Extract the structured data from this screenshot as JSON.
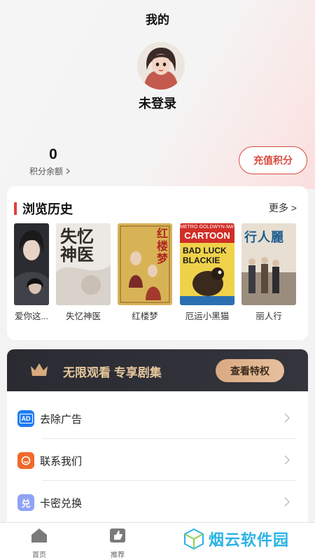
{
  "header": {
    "title": "我的"
  },
  "profile": {
    "username": "未登录",
    "points_value": "0",
    "points_label": "积分余额",
    "recharge_label": "充值积分"
  },
  "history": {
    "title": "浏览历史",
    "more_label": "更多 >",
    "items": [
      {
        "title": "爱你这...",
        "poster_text": ""
      },
      {
        "title": "失忆神医",
        "poster_text": "失忆神医"
      },
      {
        "title": "红楼梦",
        "poster_text": "红楼梦"
      },
      {
        "title": "厄运小黑猫",
        "poster_text_1": "BAD LUCK",
        "poster_text_2": "BLACKIE",
        "poster_text_3": "CARTOON"
      },
      {
        "title": "丽人行",
        "poster_text": "行人麗"
      }
    ]
  },
  "vip": {
    "text": "无限观看 专享剧集",
    "button_label": "查看特权"
  },
  "menu": {
    "items": [
      {
        "label": "去除广告",
        "icon": "ad-icon",
        "icon_text": "AD",
        "color": "#1f7cf0"
      },
      {
        "label": "联系我们",
        "icon": "contact-icon",
        "icon_text": "",
        "color": "#f06a2a"
      },
      {
        "label": "卡密兑换",
        "icon": "redeem-icon",
        "icon_text": "兑",
        "color": "#8fa3f5"
      }
    ]
  },
  "tabbar": {
    "items": [
      {
        "label": "首页",
        "icon": "home-icon"
      },
      {
        "label": "推荐",
        "icon": "recommend-icon"
      }
    ]
  },
  "watermark": {
    "text": "烟云软件园"
  },
  "colors": {
    "accent": "#d94b3f",
    "vip_gold": "#e6c79c",
    "vip_dark": "#2a2b32",
    "watermark": "#2bb3e6"
  }
}
